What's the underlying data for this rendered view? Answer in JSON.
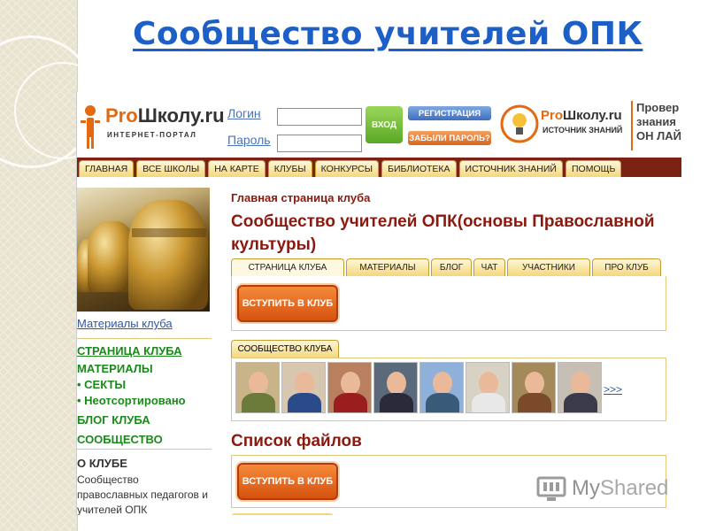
{
  "slide": {
    "title": "Сообщество учителей ОПК"
  },
  "header": {
    "logo_pro": "Pro",
    "logo_rest": "Школу.ru",
    "logo_sub": "ИНТЕРНЕТ-ПОРТАЛ",
    "login_label": "Логин",
    "password_label": "Пароль",
    "login_value": "",
    "password_value": "",
    "enter_button": "ВХОД",
    "register_button": "РЕГИСТРАЦИЯ",
    "forgot_button": "ЗАБЫЛИ ПАРОЛЬ?",
    "logo2_pro": "Pro",
    "logo2_rest": "Школу.ru",
    "logo2_sub": "ИСТОЧНИК ЗНАНИЙ",
    "promo_lines": [
      "Провер",
      "знания",
      "ОН ЛАЙ"
    ]
  },
  "nav": {
    "items": [
      "ГЛАВНАЯ",
      "ВСЕ ШКОЛЫ",
      "НА КАРТЕ",
      "КЛУБЫ",
      "КОНКУРСЫ",
      "БИБЛИОТЕКА",
      "ИСТОЧНИК ЗНАНИЙ",
      "ПОМОЩЬ"
    ]
  },
  "sidebar": {
    "materials_link": "Материалы клуба",
    "menu": [
      "СТРАНИЦА КЛУБА",
      "МАТЕРИАЛЫ",
      "• СЕКТЫ",
      "• Неотсортировано",
      "БЛОГ КЛУБА",
      "СООБЩЕСТВО"
    ],
    "about_heading": "О КЛУБЕ",
    "about_text": "Сообщество православных педагогов и учителей ОПК"
  },
  "main": {
    "breadcrumb": "Главная страница клуба",
    "club_title": "Сообщество учителей ОПК(основы Православной культуры)",
    "tabs": [
      "СТРАНИЦА КЛУБА",
      "МАТЕРИАЛЫ",
      "БЛОГ",
      "ЧАТ",
      "УЧАСТНИКИ",
      "ПРО КЛУБ"
    ],
    "join_button": "ВСТУПИТЬ В КЛУБ",
    "community_tab": "СООБЩЕСТВО КЛУБА",
    "more_link": ">>>",
    "files_heading": "Список файлов",
    "join_button_2": "ВСТУПИТЬ В КЛУБ"
  },
  "colors": {
    "title_blue": "#1b5fc7",
    "club_red": "#8a1a10",
    "menu_green": "#1a8a1a",
    "nav_bg": "#7b2213",
    "accent_orange": "#e36a10"
  },
  "watermark": {
    "my": "My",
    "shared": "Shared"
  }
}
